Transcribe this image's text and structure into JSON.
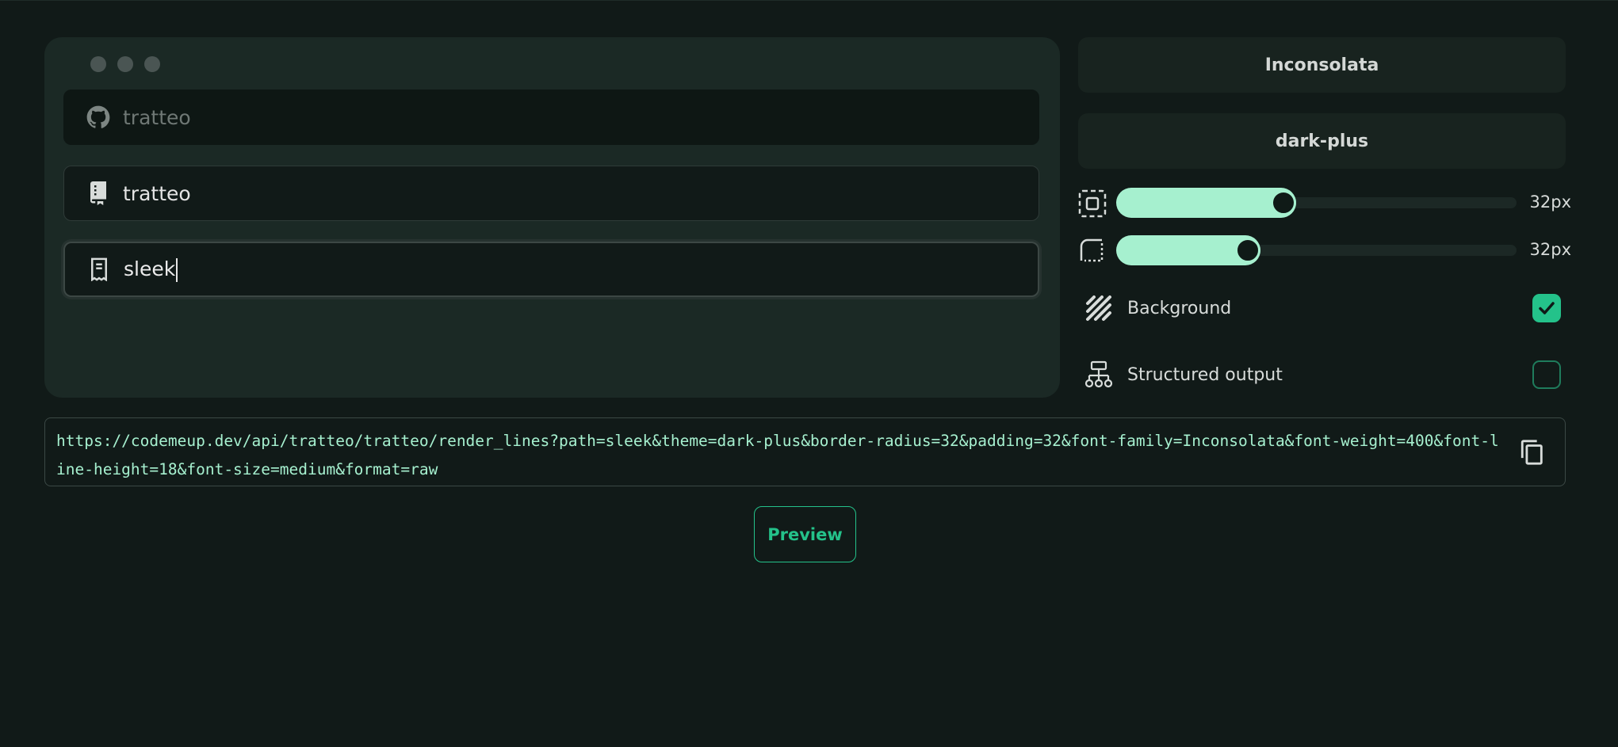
{
  "inputs": {
    "owner": {
      "value": "tratteo",
      "icon": "github-icon"
    },
    "repo": {
      "value": "tratteo",
      "icon": "repo-book-icon"
    },
    "path": {
      "value": "sleek",
      "icon": "file-document-icon"
    }
  },
  "settings": {
    "font_family": "Inconsolata",
    "theme": "dark-plus",
    "padding": {
      "value_label": "32px",
      "fraction": 0.41,
      "icon": "padding-icon"
    },
    "border_radius": {
      "value_label": "32px",
      "fraction": 0.32,
      "icon": "border-radius-icon"
    },
    "background": {
      "label": "Background",
      "checked": true,
      "icon": "background-pattern-icon"
    },
    "structured_output": {
      "label": "Structured output",
      "checked": false,
      "icon": "structure-tree-icon"
    }
  },
  "url": {
    "value": "https://codemeup.dev/api/tratteo/tratteo/render_lines?path=sleek&theme=dark-plus&border-radius=32&padding=32&font-family=Inconsolata&font-weight=400&font-line-height=18&font-size=medium&format=raw",
    "copy_icon": "copy-icon"
  },
  "actions": {
    "preview_label": "Preview"
  },
  "colors": {
    "accent": "#24c28a",
    "accent_light": "#a6f0cf",
    "background": "#111a18",
    "panel": "#1b2925"
  }
}
